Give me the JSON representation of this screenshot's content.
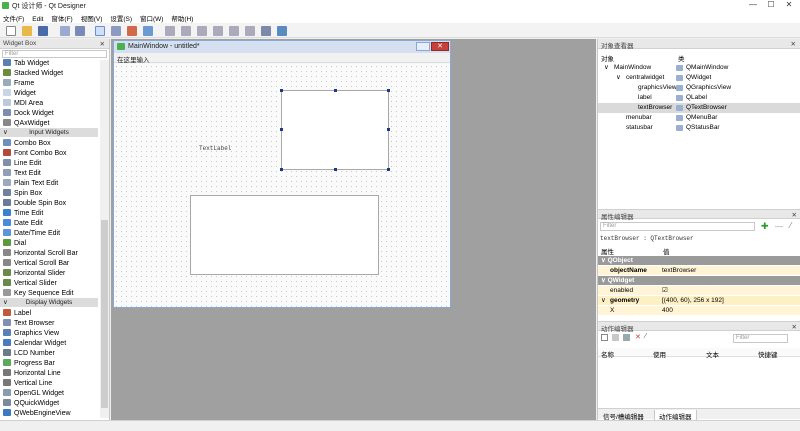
{
  "window": {
    "title": "Qt 设计师 - Qt Designer",
    "controls": [
      "—",
      "☐",
      "✕"
    ]
  },
  "menu": [
    "文件(F)",
    "Edit",
    "窗体(F)",
    "视图(V)",
    "设置(S)",
    "窗口(W)",
    "帮助(H)"
  ],
  "widget_box": {
    "title": "Widget Box",
    "filter_placeholder": "Filter",
    "items": [
      {
        "label": "Tab Widget",
        "color": "#5a7fb5"
      },
      {
        "label": "Stacked Widget",
        "color": "#6b8e3e"
      },
      {
        "label": "Frame",
        "color": "#9ab"
      },
      {
        "label": "Widget",
        "color": "#c8d4e8"
      },
      {
        "label": "MDI Area",
        "color": "#b9c9e0"
      },
      {
        "label": "Dock Widget",
        "color": "#7a8fb0"
      },
      {
        "label": "QAxWidget",
        "color": "#888"
      },
      {
        "category": "Input Widgets"
      },
      {
        "label": "Combo Box",
        "color": "#6f8fbf"
      },
      {
        "label": "Font Combo Box",
        "color": "#b04a3a"
      },
      {
        "label": "Line Edit",
        "color": "#7f8fa8"
      },
      {
        "label": "Text Edit",
        "color": "#8f9fb8"
      },
      {
        "label": "Plain Text Edit",
        "color": "#9aa8c0"
      },
      {
        "label": "Spin Box",
        "color": "#7080a0"
      },
      {
        "label": "Double Spin Box",
        "color": "#6a7a98"
      },
      {
        "label": "Time Edit",
        "color": "#3b7fd0"
      },
      {
        "label": "Date Edit",
        "color": "#4a8ad8"
      },
      {
        "label": "Date/Time Edit",
        "color": "#5a95dd"
      },
      {
        "label": "Dial",
        "color": "#5a9a3a"
      },
      {
        "label": "Horizontal Scroll Bar",
        "color": "#888"
      },
      {
        "label": "Vertical Scroll Bar",
        "color": "#888"
      },
      {
        "label": "Horizontal Slider",
        "color": "#6a8a4a"
      },
      {
        "label": "Vertical Slider",
        "color": "#6a8a4a"
      },
      {
        "label": "Key Sequence Edit",
        "color": "#999"
      },
      {
        "category": "Display Widgets"
      },
      {
        "label": "Label",
        "color": "#c05a3a"
      },
      {
        "label": "Text Browser",
        "color": "#8090b0"
      },
      {
        "label": "Graphics View",
        "color": "#5a7fb5"
      },
      {
        "label": "Calendar Widget",
        "color": "#4a7ac0"
      },
      {
        "label": "LCD Number",
        "color": "#6a7a8a"
      },
      {
        "label": "Progress Bar",
        "color": "#5aaa5a"
      },
      {
        "label": "Horizontal Line",
        "color": "#777"
      },
      {
        "label": "Vertical Line",
        "color": "#777"
      },
      {
        "label": "OpenGL Widget",
        "color": "#8a9ab0"
      },
      {
        "label": "QQuickWidget",
        "color": "#7a8a9a"
      },
      {
        "label": "QWebEngineView",
        "color": "#3a7ac0"
      }
    ]
  },
  "form": {
    "title": "MainWindow - untitled*",
    "menu_placeholder": "在这里输入",
    "text_label": "TextLabel"
  },
  "object_inspector": {
    "title": "对象查看器",
    "headers": [
      "对象",
      "类"
    ],
    "rows": [
      {
        "name": "MainWindow",
        "cls": "QMainWindow",
        "indent": 0,
        "expand": "∨"
      },
      {
        "name": "centralwidget",
        "cls": "QWidget",
        "indent": 1,
        "expand": "∨"
      },
      {
        "name": "graphicsView",
        "cls": "QGraphicsView",
        "indent": 2,
        "expand": ""
      },
      {
        "name": "label",
        "cls": "QLabel",
        "indent": 2,
        "expand": ""
      },
      {
        "name": "textBrowser",
        "cls": "QTextBrowser",
        "indent": 2,
        "expand": "",
        "selected": true
      },
      {
        "name": "menubar",
        "cls": "QMenuBar",
        "indent": 1,
        "expand": ""
      },
      {
        "name": "statusbar",
        "cls": "QStatusBar",
        "indent": 1,
        "expand": ""
      }
    ]
  },
  "property_editor": {
    "title": "属性编辑器",
    "filter_placeholder": "Filter",
    "object_line": "textBrowser : QTextBrowser",
    "headers": [
      "属性",
      "值"
    ],
    "rows": [
      {
        "type": "section",
        "name": "QObject"
      },
      {
        "type": "prop",
        "name": "objectName",
        "value": "textBrowser",
        "bold": true
      },
      {
        "type": "section",
        "name": "QWidget"
      },
      {
        "type": "prop",
        "name": "enabled",
        "value": "☑"
      },
      {
        "type": "prop",
        "name": "geometry",
        "value": "[(400, 60), 256 x 192]",
        "bold": true,
        "expand": "∨"
      },
      {
        "type": "prop",
        "name": "X",
        "value": "400"
      }
    ]
  },
  "action_editor": {
    "title": "动作编辑器",
    "filter_placeholder": "Filter",
    "headers": [
      "名称",
      "使用",
      "文本",
      "快捷键"
    ],
    "tabs": [
      "信号/槽编辑器",
      "动作编辑器"
    ]
  }
}
